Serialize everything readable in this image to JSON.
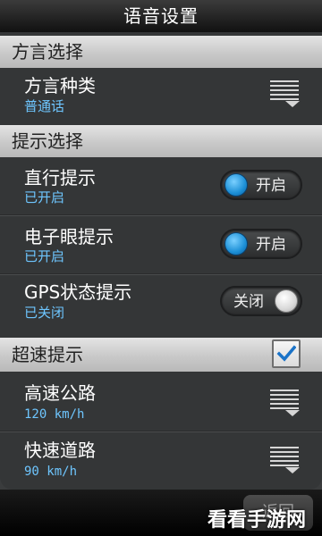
{
  "title": "语音设置",
  "sections": {
    "dialect_header": "方言选择",
    "tip_header": "提示选择",
    "speed_header": "超速提示"
  },
  "dialect_type": {
    "label": "方言种类",
    "value": "普通话",
    "icon": "list-dropdown-icon"
  },
  "straight_tip": {
    "label": "直行提示",
    "status": "已开启",
    "toggle": "开启",
    "on": true
  },
  "camera_tip": {
    "label": "电子眼提示",
    "status": "已开启",
    "toggle": "开启",
    "on": true
  },
  "gps_tip": {
    "label": "GPS状态提示",
    "status": "已关闭",
    "toggle": "关闭",
    "on": false
  },
  "speed_checkbox": {
    "checked": true,
    "icon": "checkmark-icon"
  },
  "highway": {
    "label": "高速公路",
    "value": "120 km/h",
    "icon": "list-dropdown-icon"
  },
  "expressway": {
    "label": "快速道路",
    "value": "90 km/h",
    "icon": "list-dropdown-icon"
  },
  "bottom": {
    "back_label": "返回"
  },
  "watermark": "看看手游网",
  "colors": {
    "accent": "#1c8fd6",
    "sub_text": "#6ec6ff",
    "header_bg": "#d0d0d0",
    "panel_bg": "#343637"
  }
}
